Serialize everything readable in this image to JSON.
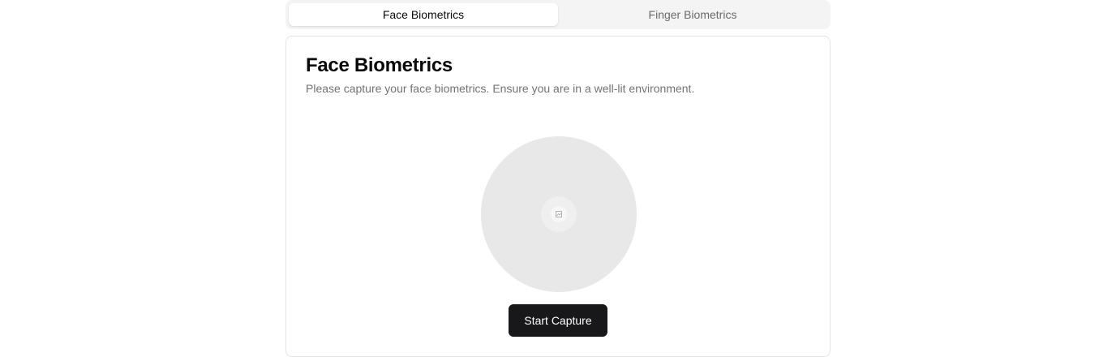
{
  "tabs": [
    {
      "label": "Face Biometrics",
      "active": true
    },
    {
      "label": "Finger Biometrics",
      "active": false
    }
  ],
  "card": {
    "title": "Face Biometrics",
    "description": "Please capture your face biometrics. Ensure you are in a well-lit environment.",
    "preview_icon": "camera-icon",
    "button_label": "Start Capture"
  },
  "colors": {
    "primary_button": "#18181b",
    "tab_track": "#f4f4f5",
    "preview_bg": "#e8e8e8",
    "muted_text": "#737373"
  }
}
